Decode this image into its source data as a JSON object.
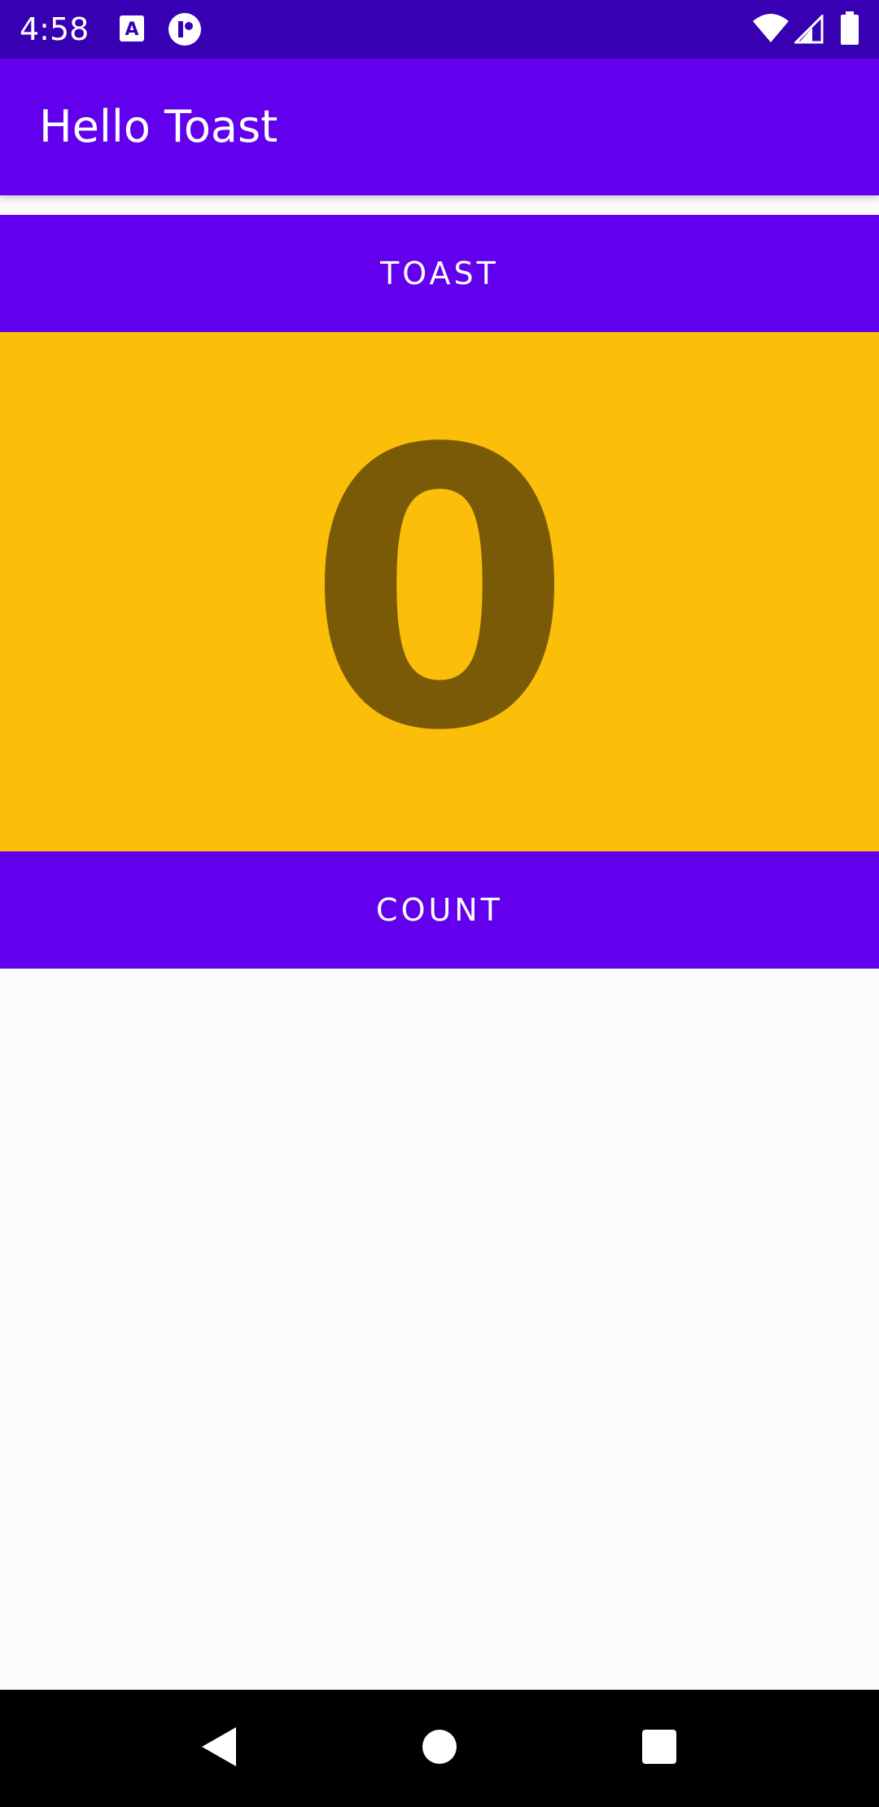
{
  "status_bar": {
    "time": "4:58",
    "icons": [
      "a-square-notification-icon",
      "app-notification-icon",
      "wifi-icon",
      "signal-icon",
      "battery-icon"
    ]
  },
  "app_bar": {
    "title": "Hello Toast"
  },
  "buttons": {
    "toast_label": "TOAST",
    "count_label": "COUNT"
  },
  "counter": {
    "value": "0"
  },
  "navigation": {
    "icons": [
      "back-icon",
      "home-icon",
      "recents-icon"
    ]
  },
  "colors": {
    "status_bar": "#3700b3",
    "primary": "#6200ee",
    "count_panel": "#fbbf09",
    "count_text": "#7a5a06",
    "background": "#fbfbfd"
  }
}
